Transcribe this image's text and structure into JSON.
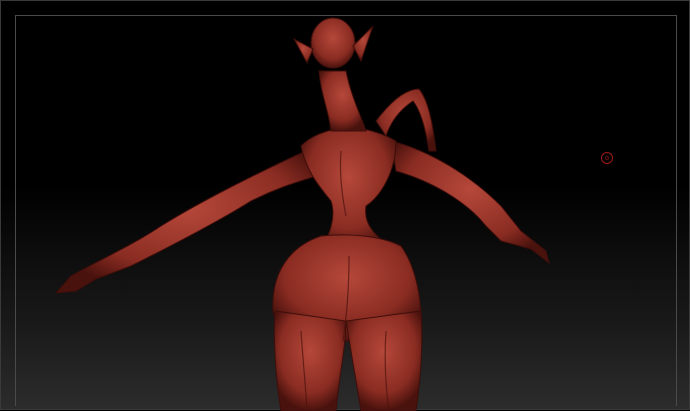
{
  "viewport": {
    "model_color": "#8a2c22",
    "highlight_color": "#b5483a",
    "shadow_color": "#3e0e0a",
    "background_top": "#000000",
    "background_bottom": "#2c2c2c"
  },
  "cursor": {
    "icon": "brush-cursor-icon",
    "color": "#a01818"
  }
}
